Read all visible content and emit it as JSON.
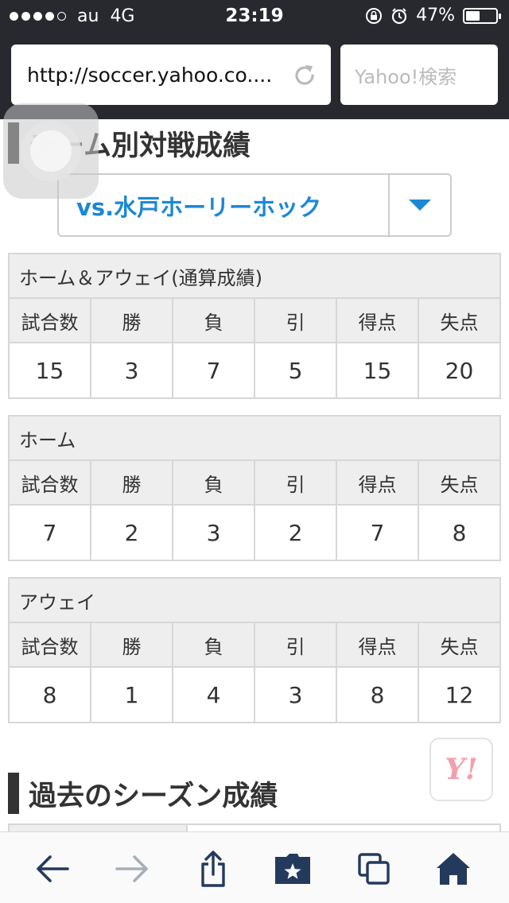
{
  "status_bar": {
    "carrier": "au",
    "network": "4G",
    "time": "23:19",
    "battery_percent": "47%",
    "battery_level": 0.47
  },
  "browser": {
    "url": "http://soccer.yahoo.co....",
    "search_placeholder": "Yahoo!検索"
  },
  "sections": {
    "team_record_title": "チーム別対戦成績",
    "past_season_title": "過去のシーズン成績"
  },
  "team_select": {
    "selected": "vs.水戸ホーリーホック"
  },
  "tables": [
    {
      "caption": "ホーム＆アウェイ(通算成績)",
      "headers": [
        "試合数",
        "勝",
        "負",
        "引",
        "得点",
        "失点"
      ],
      "values": [
        "15",
        "3",
        "7",
        "5",
        "15",
        "20"
      ]
    },
    {
      "caption": "ホーム",
      "headers": [
        "試合数",
        "勝",
        "負",
        "引",
        "得点",
        "失点"
      ],
      "values": [
        "7",
        "2",
        "3",
        "2",
        "7",
        "8"
      ]
    },
    {
      "caption": "アウェイ",
      "headers": [
        "試合数",
        "勝",
        "負",
        "引",
        "得点",
        "失点"
      ],
      "values": [
        "8",
        "1",
        "4",
        "3",
        "8",
        "12"
      ]
    }
  ],
  "floating_button": {
    "logo_text": "Y!"
  },
  "colors": {
    "chrome_dark": "#27292f",
    "link_blue": "#1b88d4",
    "header_gray": "#eeeeee",
    "toolbar_blue": "#233a5c"
  },
  "icons": {
    "back": "arrow-left-icon",
    "forward": "arrow-right-icon",
    "share": "share-icon",
    "bookmarks": "bookmark-star-icon",
    "tabs": "tabs-icon",
    "home": "home-icon",
    "reload": "reload-icon"
  }
}
